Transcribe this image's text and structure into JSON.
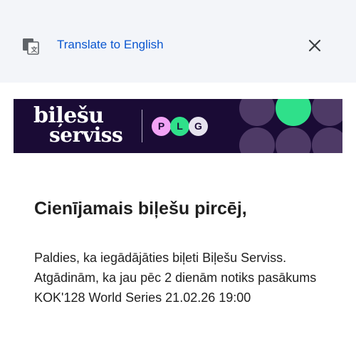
{
  "translate_bar": {
    "icon": "google-translate-icon",
    "link_label": "Translate to English",
    "close_icon": "close-icon"
  },
  "banner": {
    "logo_line1": "biļešu",
    "logo_line2": "serviss",
    "partner_letters": [
      "P",
      "L",
      "G"
    ],
    "colors": {
      "background": "#1a0b35",
      "pink": "#f2a3f5",
      "green": "#2fe08a",
      "light": "#e6e3ee",
      "circle": "#4e3a66"
    }
  },
  "content": {
    "title": "Cienījamais biļešu pircēj,",
    "body": "Paldies, ka iegādājāties biļeti Biļešu Serviss. Atgādinām, ka jau pēc 2 dienām notiks pasākums KOK'128 World Series 21.02.26 19:00"
  }
}
